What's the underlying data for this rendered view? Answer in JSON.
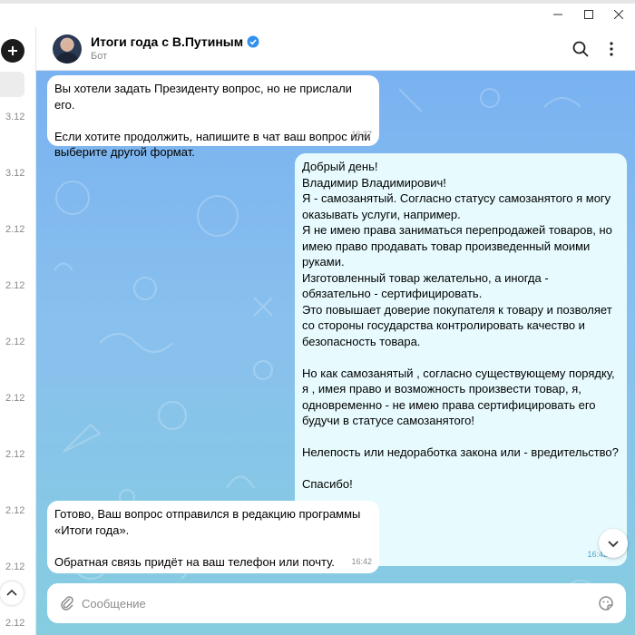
{
  "window": {
    "minimize_icon": "minimize-icon",
    "maximize_icon": "maximize-icon",
    "close_icon": "close-icon"
  },
  "sidebar": {
    "compose_icon": "plus-icon",
    "dates": [
      "3.12",
      "3.12",
      "2.12",
      "2.12",
      "2.12",
      "2.12",
      "2.12",
      "2.12",
      "2.12",
      "2.12"
    ],
    "scroll_up_icon": "chevron-up-icon"
  },
  "header": {
    "title": "Итоги года с В.Путиным",
    "status": "Бот",
    "verified_icon": "verified-badge-icon",
    "search_icon": "search-icon",
    "more_icon": "more-vertical-icon"
  },
  "messages": [
    {
      "direction": "incoming",
      "text": "Вы хотели задать Президенту вопрос, но не прислали его.\n\nЕсли хотите продолжить, напишите в чат ваш вопрос или выберите другой формат.",
      "time": "16:37"
    },
    {
      "direction": "outgoing",
      "text": "Добрый день!\nВладимир Владимирович!\nЯ - самозанятый.  Согласно статусу самозанятого я могу оказывать услуги, например.\nЯ не имею права заниматься перепродажей товаров, но имею право продавать товар произведенный моими руками.\nИзготовленный товар  желательно, а иногда - обязательно - сертифицировать.\nЭто повышает доверие покупателя к товару и позволяет со стороны государства контролировать качество и безопасность товара.\n\nНо как самозанятый , согласно существующему порядку, я , имея право и возможность произвести товар, я, одновременно - не имею права сертифицировать его будучи в статусе самозанятого!\n\nНелепость или недоработка закона  или - вредительство?\n\nСпасибо!",
      "time": "16:42",
      "read_icon": "check-icon"
    },
    {
      "direction": "incoming",
      "text": "Готово, Ваш вопрос отправился в редакцию программы «Итоги года».\n\nОбратная связь придёт на ваш телефон или почту.",
      "time": "16:42"
    }
  ],
  "scroll_down_icon": "chevron-down-icon",
  "composer": {
    "placeholder": "Сообщение",
    "attach_icon": "paperclip-icon",
    "sticker_icon": "sticker-icon"
  },
  "colors": {
    "accent": "#3390ec",
    "chat_bg_top": "#79b2f0",
    "chat_bg_bottom": "#86cde0",
    "outgoing_bubble": "#e7fbfe",
    "incoming_bubble": "#ffffff"
  }
}
